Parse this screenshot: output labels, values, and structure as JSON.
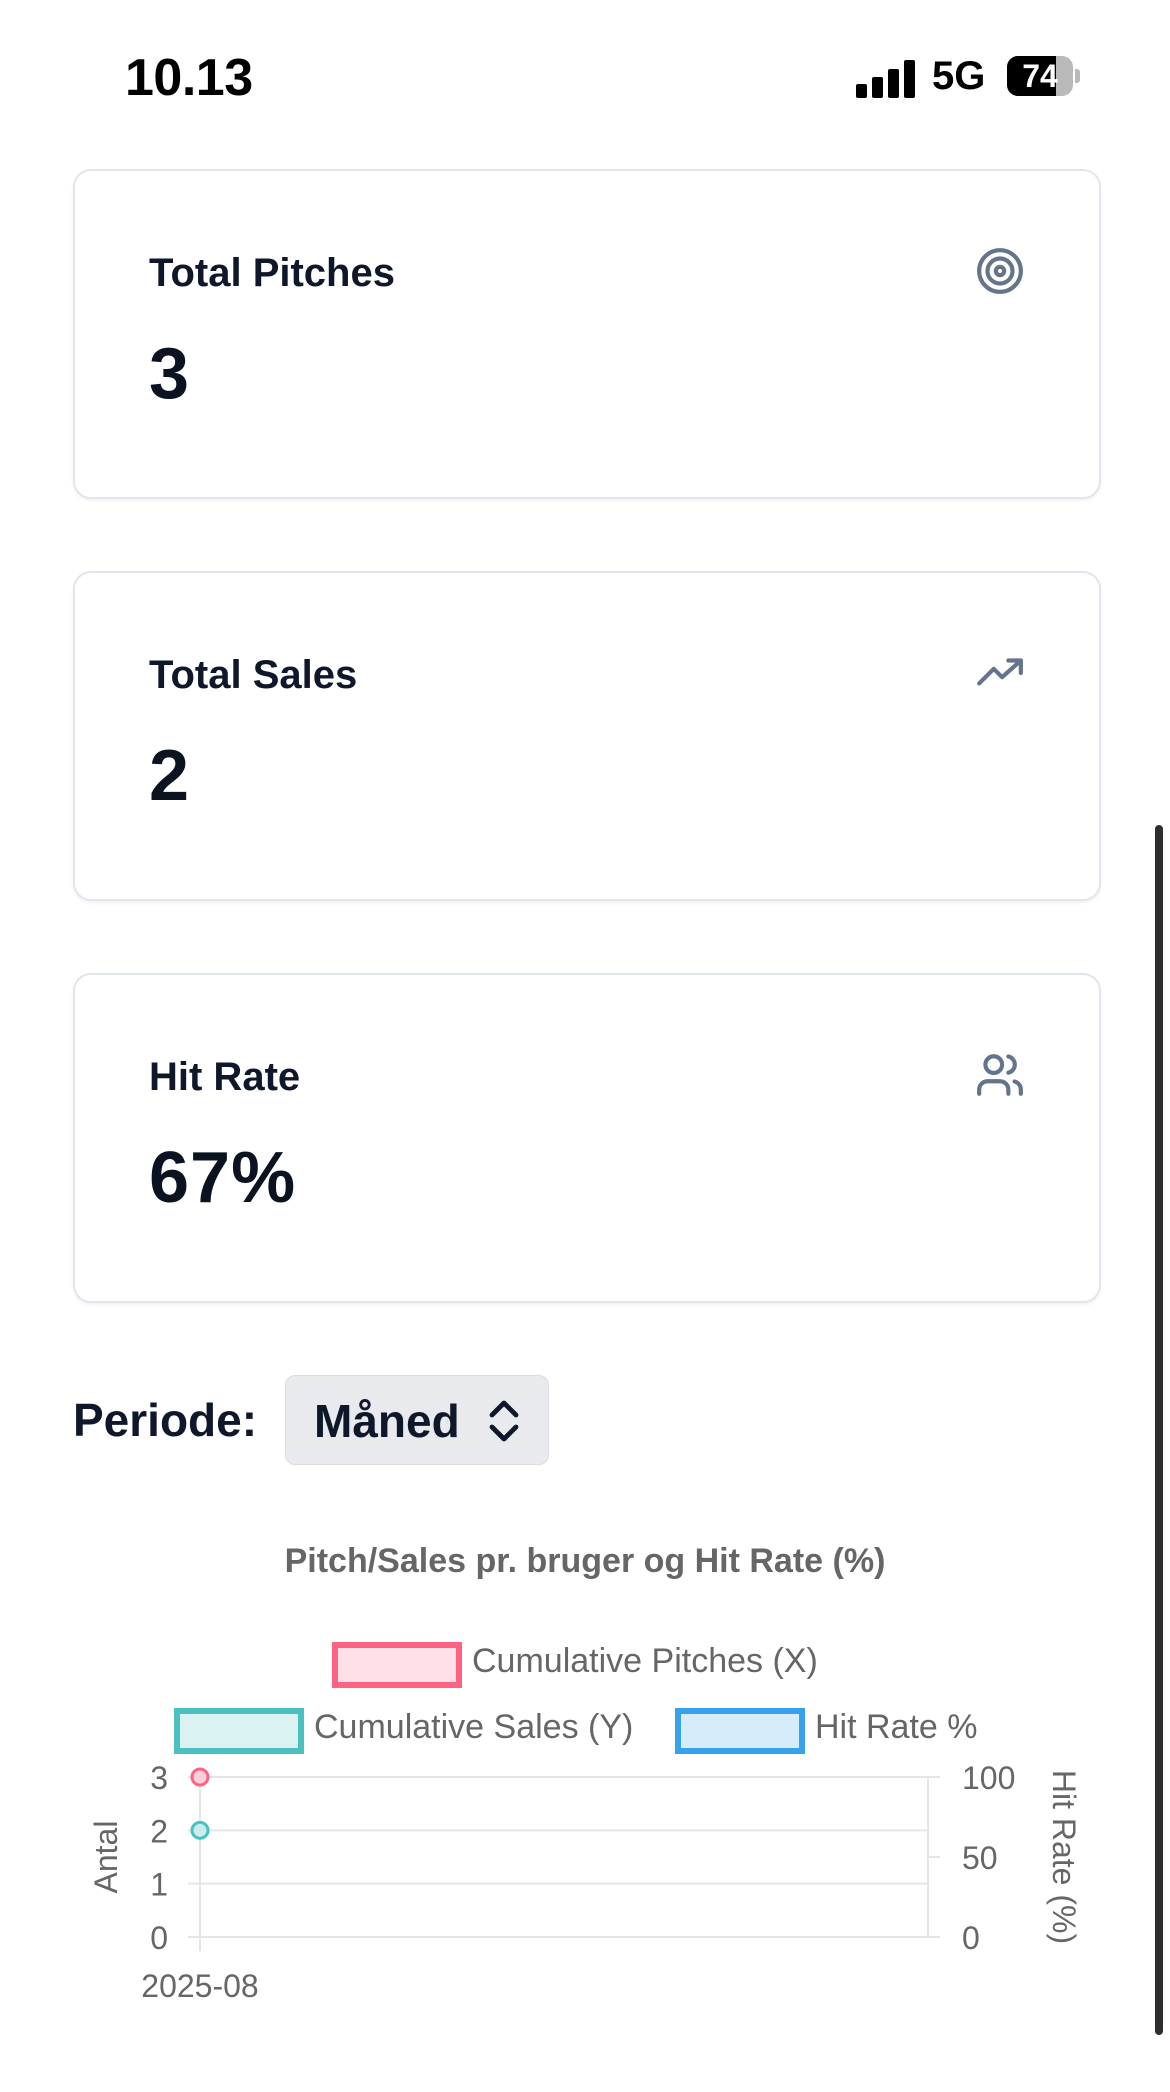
{
  "status_bar": {
    "time": "10.13",
    "network": "5G",
    "battery_percent": "74",
    "battery_level": 0.74
  },
  "cards": [
    {
      "label": "Total Pitches",
      "value": "3",
      "icon": "target-icon"
    },
    {
      "label": "Total Sales",
      "value": "2",
      "icon": "trending-up-icon"
    },
    {
      "label": "Hit Rate",
      "value": "67%",
      "icon": "users-icon"
    }
  ],
  "period": {
    "label": "Periode:",
    "selected": "Måned",
    "icon": "chevron-up-down-icon"
  },
  "colors": {
    "pitches": "#ff6384",
    "sales": "#4bc0c0",
    "hit_rate": "#36a2eb"
  },
  "chart_data": {
    "type": "line",
    "title": "Pitch/Sales pr. bruger og Hit Rate (%)",
    "categories": [
      "2025-08"
    ],
    "series": [
      {
        "name": "Cumulative Pitches (X)",
        "values": [
          3
        ],
        "axis": "left"
      },
      {
        "name": "Cumulative Sales (Y)",
        "values": [
          2
        ],
        "axis": "left"
      },
      {
        "name": "Hit Rate %",
        "values": [],
        "axis": "right"
      }
    ],
    "y_left": {
      "label": "Antal",
      "range": [
        0,
        3
      ],
      "ticks": [
        "0",
        "1",
        "2",
        "3"
      ]
    },
    "y_right": {
      "label": "Hit Rate (%)",
      "range": [
        0,
        100
      ],
      "ticks": [
        "0",
        "50",
        "100"
      ]
    },
    "legend_position": "top",
    "grid": true
  }
}
